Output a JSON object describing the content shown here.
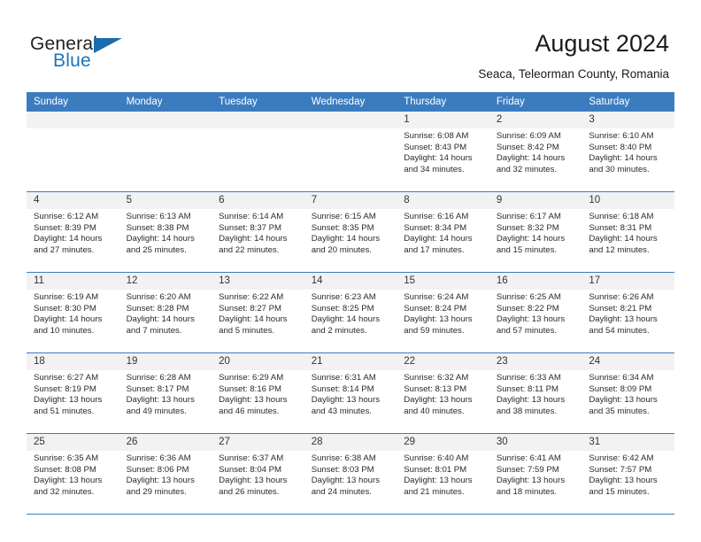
{
  "brand": {
    "name_part1": "General",
    "name_part2": "Blue",
    "accent_color": "#1b6cad"
  },
  "header": {
    "title": "August 2024",
    "subtitle": "Seaca, Teleorman County, Romania"
  },
  "calendar": {
    "header_bg": "#3b7cbf",
    "daynum_bg": "#f2f2f2",
    "weekdays": [
      "Sunday",
      "Monday",
      "Tuesday",
      "Wednesday",
      "Thursday",
      "Friday",
      "Saturday"
    ],
    "weeks": [
      [
        {
          "day": "",
          "empty": true
        },
        {
          "day": "",
          "empty": true
        },
        {
          "day": "",
          "empty": true
        },
        {
          "day": "",
          "empty": true
        },
        {
          "day": "1",
          "sunrise": "Sunrise: 6:08 AM",
          "sunset": "Sunset: 8:43 PM",
          "daylight1": "Daylight: 14 hours",
          "daylight2": "and 34 minutes."
        },
        {
          "day": "2",
          "sunrise": "Sunrise: 6:09 AM",
          "sunset": "Sunset: 8:42 PM",
          "daylight1": "Daylight: 14 hours",
          "daylight2": "and 32 minutes."
        },
        {
          "day": "3",
          "sunrise": "Sunrise: 6:10 AM",
          "sunset": "Sunset: 8:40 PM",
          "daylight1": "Daylight: 14 hours",
          "daylight2": "and 30 minutes."
        }
      ],
      [
        {
          "day": "4",
          "sunrise": "Sunrise: 6:12 AM",
          "sunset": "Sunset: 8:39 PM",
          "daylight1": "Daylight: 14 hours",
          "daylight2": "and 27 minutes."
        },
        {
          "day": "5",
          "sunrise": "Sunrise: 6:13 AM",
          "sunset": "Sunset: 8:38 PM",
          "daylight1": "Daylight: 14 hours",
          "daylight2": "and 25 minutes."
        },
        {
          "day": "6",
          "sunrise": "Sunrise: 6:14 AM",
          "sunset": "Sunset: 8:37 PM",
          "daylight1": "Daylight: 14 hours",
          "daylight2": "and 22 minutes."
        },
        {
          "day": "7",
          "sunrise": "Sunrise: 6:15 AM",
          "sunset": "Sunset: 8:35 PM",
          "daylight1": "Daylight: 14 hours",
          "daylight2": "and 20 minutes."
        },
        {
          "day": "8",
          "sunrise": "Sunrise: 6:16 AM",
          "sunset": "Sunset: 8:34 PM",
          "daylight1": "Daylight: 14 hours",
          "daylight2": "and 17 minutes."
        },
        {
          "day": "9",
          "sunrise": "Sunrise: 6:17 AM",
          "sunset": "Sunset: 8:32 PM",
          "daylight1": "Daylight: 14 hours",
          "daylight2": "and 15 minutes."
        },
        {
          "day": "10",
          "sunrise": "Sunrise: 6:18 AM",
          "sunset": "Sunset: 8:31 PM",
          "daylight1": "Daylight: 14 hours",
          "daylight2": "and 12 minutes."
        }
      ],
      [
        {
          "day": "11",
          "sunrise": "Sunrise: 6:19 AM",
          "sunset": "Sunset: 8:30 PM",
          "daylight1": "Daylight: 14 hours",
          "daylight2": "and 10 minutes."
        },
        {
          "day": "12",
          "sunrise": "Sunrise: 6:20 AM",
          "sunset": "Sunset: 8:28 PM",
          "daylight1": "Daylight: 14 hours",
          "daylight2": "and 7 minutes."
        },
        {
          "day": "13",
          "sunrise": "Sunrise: 6:22 AM",
          "sunset": "Sunset: 8:27 PM",
          "daylight1": "Daylight: 14 hours",
          "daylight2": "and 5 minutes."
        },
        {
          "day": "14",
          "sunrise": "Sunrise: 6:23 AM",
          "sunset": "Sunset: 8:25 PM",
          "daylight1": "Daylight: 14 hours",
          "daylight2": "and 2 minutes."
        },
        {
          "day": "15",
          "sunrise": "Sunrise: 6:24 AM",
          "sunset": "Sunset: 8:24 PM",
          "daylight1": "Daylight: 13 hours",
          "daylight2": "and 59 minutes."
        },
        {
          "day": "16",
          "sunrise": "Sunrise: 6:25 AM",
          "sunset": "Sunset: 8:22 PM",
          "daylight1": "Daylight: 13 hours",
          "daylight2": "and 57 minutes."
        },
        {
          "day": "17",
          "sunrise": "Sunrise: 6:26 AM",
          "sunset": "Sunset: 8:21 PM",
          "daylight1": "Daylight: 13 hours",
          "daylight2": "and 54 minutes."
        }
      ],
      [
        {
          "day": "18",
          "sunrise": "Sunrise: 6:27 AM",
          "sunset": "Sunset: 8:19 PM",
          "daylight1": "Daylight: 13 hours",
          "daylight2": "and 51 minutes."
        },
        {
          "day": "19",
          "sunrise": "Sunrise: 6:28 AM",
          "sunset": "Sunset: 8:17 PM",
          "daylight1": "Daylight: 13 hours",
          "daylight2": "and 49 minutes."
        },
        {
          "day": "20",
          "sunrise": "Sunrise: 6:29 AM",
          "sunset": "Sunset: 8:16 PM",
          "daylight1": "Daylight: 13 hours",
          "daylight2": "and 46 minutes."
        },
        {
          "day": "21",
          "sunrise": "Sunrise: 6:31 AM",
          "sunset": "Sunset: 8:14 PM",
          "daylight1": "Daylight: 13 hours",
          "daylight2": "and 43 minutes."
        },
        {
          "day": "22",
          "sunrise": "Sunrise: 6:32 AM",
          "sunset": "Sunset: 8:13 PM",
          "daylight1": "Daylight: 13 hours",
          "daylight2": "and 40 minutes."
        },
        {
          "day": "23",
          "sunrise": "Sunrise: 6:33 AM",
          "sunset": "Sunset: 8:11 PM",
          "daylight1": "Daylight: 13 hours",
          "daylight2": "and 38 minutes."
        },
        {
          "day": "24",
          "sunrise": "Sunrise: 6:34 AM",
          "sunset": "Sunset: 8:09 PM",
          "daylight1": "Daylight: 13 hours",
          "daylight2": "and 35 minutes."
        }
      ],
      [
        {
          "day": "25",
          "sunrise": "Sunrise: 6:35 AM",
          "sunset": "Sunset: 8:08 PM",
          "daylight1": "Daylight: 13 hours",
          "daylight2": "and 32 minutes."
        },
        {
          "day": "26",
          "sunrise": "Sunrise: 6:36 AM",
          "sunset": "Sunset: 8:06 PM",
          "daylight1": "Daylight: 13 hours",
          "daylight2": "and 29 minutes."
        },
        {
          "day": "27",
          "sunrise": "Sunrise: 6:37 AM",
          "sunset": "Sunset: 8:04 PM",
          "daylight1": "Daylight: 13 hours",
          "daylight2": "and 26 minutes."
        },
        {
          "day": "28",
          "sunrise": "Sunrise: 6:38 AM",
          "sunset": "Sunset: 8:03 PM",
          "daylight1": "Daylight: 13 hours",
          "daylight2": "and 24 minutes."
        },
        {
          "day": "29",
          "sunrise": "Sunrise: 6:40 AM",
          "sunset": "Sunset: 8:01 PM",
          "daylight1": "Daylight: 13 hours",
          "daylight2": "and 21 minutes."
        },
        {
          "day": "30",
          "sunrise": "Sunrise: 6:41 AM",
          "sunset": "Sunset: 7:59 PM",
          "daylight1": "Daylight: 13 hours",
          "daylight2": "and 18 minutes."
        },
        {
          "day": "31",
          "sunrise": "Sunrise: 6:42 AM",
          "sunset": "Sunset: 7:57 PM",
          "daylight1": "Daylight: 13 hours",
          "daylight2": "and 15 minutes."
        }
      ]
    ]
  }
}
